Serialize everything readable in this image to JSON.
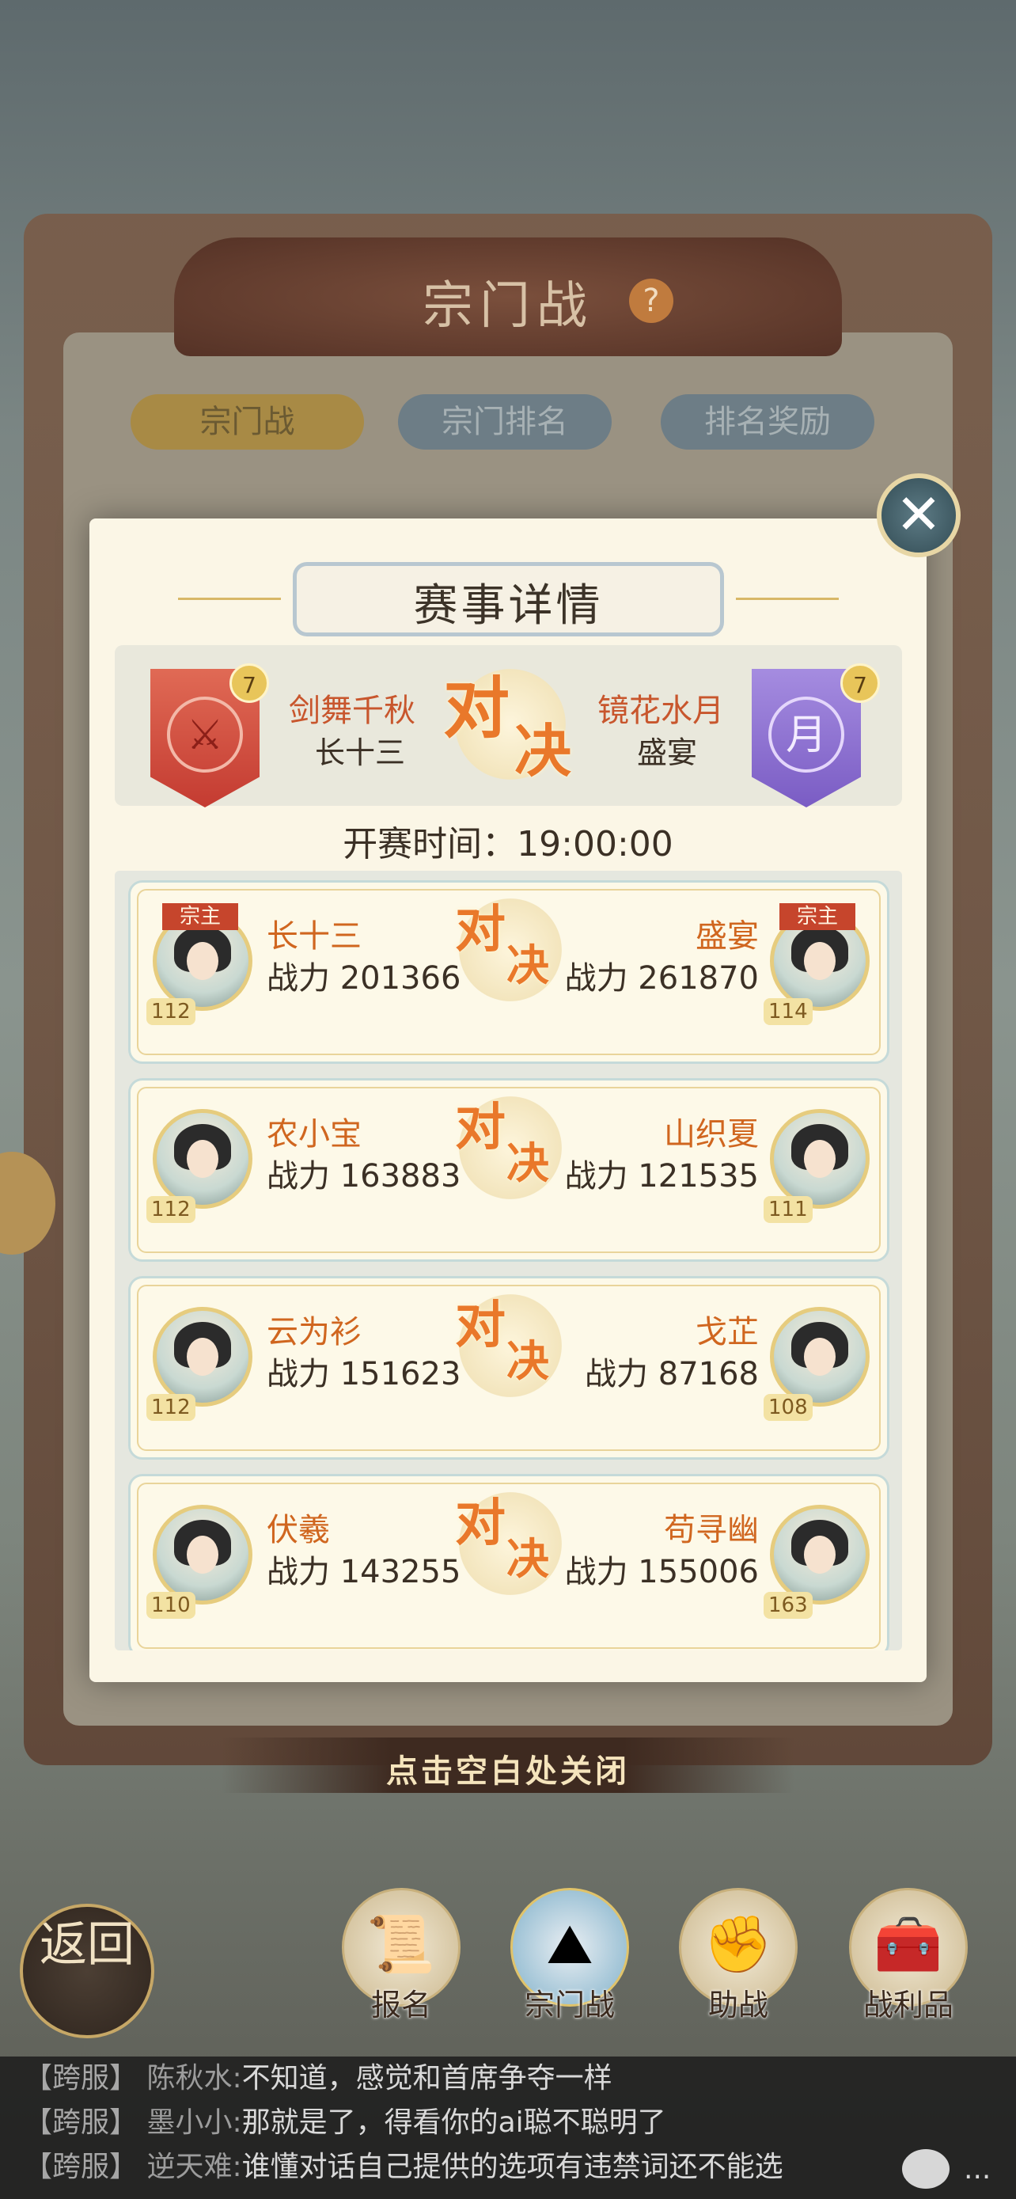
{
  "background": {
    "title": "宗门战",
    "help_icon": "?",
    "tabs": [
      "宗门战",
      "宗门排名",
      "排名奖励"
    ]
  },
  "modal": {
    "title": "赛事详情",
    "close_icon": "close-icon",
    "left_sect": {
      "name": "剑舞千秋",
      "leader": "长十三",
      "level": "7",
      "emblem": "crossed-swords-icon"
    },
    "right_sect": {
      "name": "镜花水月",
      "leader": "盛宴",
      "level": "7",
      "emblem_text": "月"
    },
    "vs_a": "对",
    "vs_b": "决",
    "start_time": "开赛时间：19:00:00",
    "leader_tag": "宗主",
    "matches": [
      {
        "left": {
          "name": "长十三",
          "power": "战力 201366",
          "level": "112"
        },
        "right": {
          "name": "盛宴",
          "power": "战力 261870",
          "level": "114"
        }
      },
      {
        "left": {
          "name": "农小宝",
          "power": "战力 163883",
          "level": "112"
        },
        "right": {
          "name": "山织夏",
          "power": "战力 121535",
          "level": "111"
        }
      },
      {
        "left": {
          "name": "云为衫",
          "power": "战力 151623",
          "level": "112"
        },
        "right": {
          "name": "戈芷",
          "power": "战力 87168",
          "level": "108"
        }
      },
      {
        "left": {
          "name": "伏羲",
          "power": "战力 143255",
          "level": "110"
        },
        "right": {
          "name": "苟寻幽",
          "power": "战力 155006",
          "level": "163"
        }
      }
    ]
  },
  "close_hint": "点击空白处关闭",
  "nav": {
    "back": "返回",
    "items": [
      {
        "label": "报名",
        "icon": "scroll-brush-icon"
      },
      {
        "label": "宗门战",
        "icon": "mountain-flag-icon"
      },
      {
        "label": "助战",
        "icon": "handshake-icon"
      },
      {
        "label": "战利品",
        "icon": "treasure-chest-icon"
      }
    ]
  },
  "chat": [
    {
      "channel": "【跨服】",
      "user": "陈秋水:",
      "text": "不知道，感觉和首席争夺一样"
    },
    {
      "channel": "【跨服】",
      "user": "墨小小:",
      "text": "那就是了，得看你的ai聪不聪明了"
    },
    {
      "channel": "【跨服】",
      "user": "逆天难:",
      "text": "谁懂对话自己提供的选项有违禁词还不能选"
    }
  ],
  "chat_more": "..."
}
